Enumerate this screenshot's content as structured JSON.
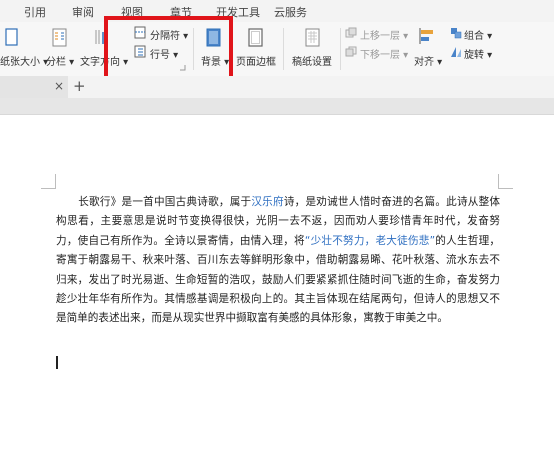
{
  "menu_tabs": [
    {
      "label": "引用"
    },
    {
      "label": "审阅"
    },
    {
      "label": "视图"
    },
    {
      "label": "章节"
    },
    {
      "label": "开发工具"
    },
    {
      "label": "云服务"
    }
  ],
  "ribbon": {
    "paper_size": "纸张大小",
    "columns": "分栏",
    "text_direction": "文字方向",
    "separator": "分隔符",
    "line_numbers": "行号",
    "background": "背景",
    "page_border": "页面边框",
    "paper_settings": "稿纸设置",
    "bring_forward": "上移一层",
    "send_backward": "下移一层",
    "align": "对齐",
    "group": "组合",
    "rotate": "旋转"
  },
  "doc_tabs": {
    "close": "×",
    "new": "+"
  },
  "document": {
    "para_intro": "长歌行》是一首中国古典诗歌，属于",
    "link1": "汉乐府",
    "para_a": "诗，是劝诫世人惜时奋进的名篇。此诗从整体构思看，主要意思是说时节变换得很快，光阴一去不返，因而劝人要珍惜青年时代，发奋努力，使自己有所作为。全诗以景寄情，由情入理，将",
    "link2": "“少壮不努力，老大徒伤悲”",
    "para_b": "的人生哲理，寄寓于朝露易干、秋来叶落、百川东去等鲜明形象中，借助朝露易晞、花叶秋落、流水东去不归来，发出了时光易逝、生命短暂的浩叹，鼓励人们要紧紧抓住随时间飞逝的生命，奋发努力趁少壮年华有所作为。其情感基调是积极向上的。其主旨体现在结尾两句，但诗人的思想又不是简单的表述出来，而是从现实世界中撷取富有美感的具体形象，寓教于审美之中。"
  }
}
